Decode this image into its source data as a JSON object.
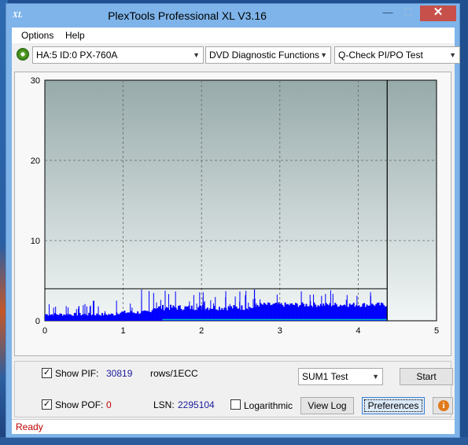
{
  "window": {
    "title": "PlexTools Professional XL V3.16",
    "app_icon_text": "XL",
    "minimize_glyph": "—",
    "maximize_glyph": "☐",
    "close_glyph": "✕"
  },
  "menu": {
    "options": "Options",
    "help": "Help"
  },
  "toolbar": {
    "drive": "HA:5 ID:0  PX-760A",
    "function": "DVD Diagnostic Functions",
    "test": "Q-Check PI/PO Test",
    "drive_icon": "disc-drive-icon"
  },
  "chart_data": {
    "type": "bar",
    "x_ticks": [
      "0",
      "1",
      "2",
      "3",
      "4",
      "5"
    ],
    "y_ticks": [
      "0",
      "10",
      "20",
      "30"
    ],
    "xlim": [
      0,
      5
    ],
    "ylim": [
      0,
      30
    ],
    "grid": true,
    "threshold_line": 4,
    "end_marker_x": 4.37,
    "pi_series_color": "#0000ff",
    "po_series_color": "#00c0c0",
    "background_gradient": [
      "#97aaaa",
      "#f2f6f6"
    ]
  },
  "controls": {
    "show_pif_label": "Show PIF:",
    "pif_value": "30819",
    "pif_unit": "rows/1ECC",
    "show_pof_label": "Show POF:",
    "pof_value": "0",
    "lsn_label": "LSN:",
    "lsn_value": "2295104",
    "logarithmic_label": "Logarithmic",
    "sum_select": "SUM1 Test",
    "start_button": "Start",
    "view_log_button": "View Log",
    "preferences_button": "Preferences",
    "info_glyph": "i",
    "pif_checked": "✓",
    "pof_checked": "✓"
  },
  "status": {
    "text": "Ready"
  }
}
